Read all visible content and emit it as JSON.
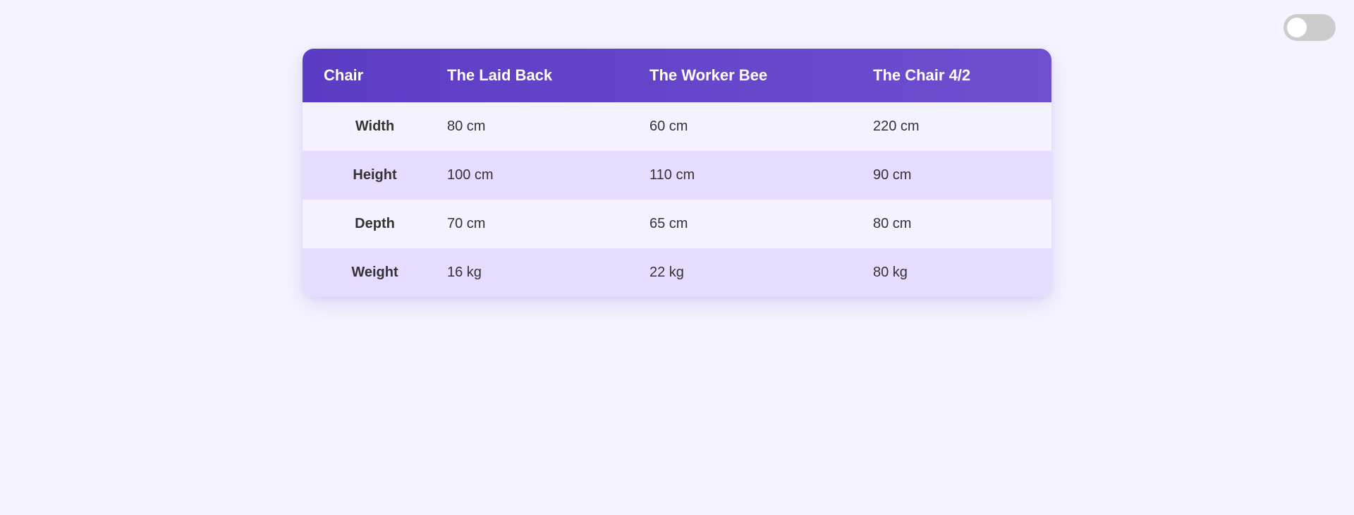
{
  "theme_toggle": {
    "state": "off",
    "track_color": "#cccccc",
    "knob_color": "#ffffff"
  },
  "colors": {
    "header_start": "#5b3cc4",
    "header_end": "#6f4fcf",
    "row_light": "#f4f2ff",
    "row_dark": "#e5dcff",
    "page_background": "#f5f3ff"
  },
  "table": {
    "headers": [
      "Chair",
      "The Laid Back",
      "The Worker Bee",
      "The Chair 4/2"
    ],
    "rows": [
      {
        "label": "Width",
        "values": [
          "80 cm",
          "60 cm",
          "220 cm"
        ]
      },
      {
        "label": "Height",
        "values": [
          "100 cm",
          "110 cm",
          "90 cm"
        ]
      },
      {
        "label": "Depth",
        "values": [
          "70 cm",
          "65 cm",
          "80 cm"
        ]
      },
      {
        "label": "Weight",
        "values": [
          "16 kg",
          "22 kg",
          "80 kg"
        ]
      }
    ]
  }
}
